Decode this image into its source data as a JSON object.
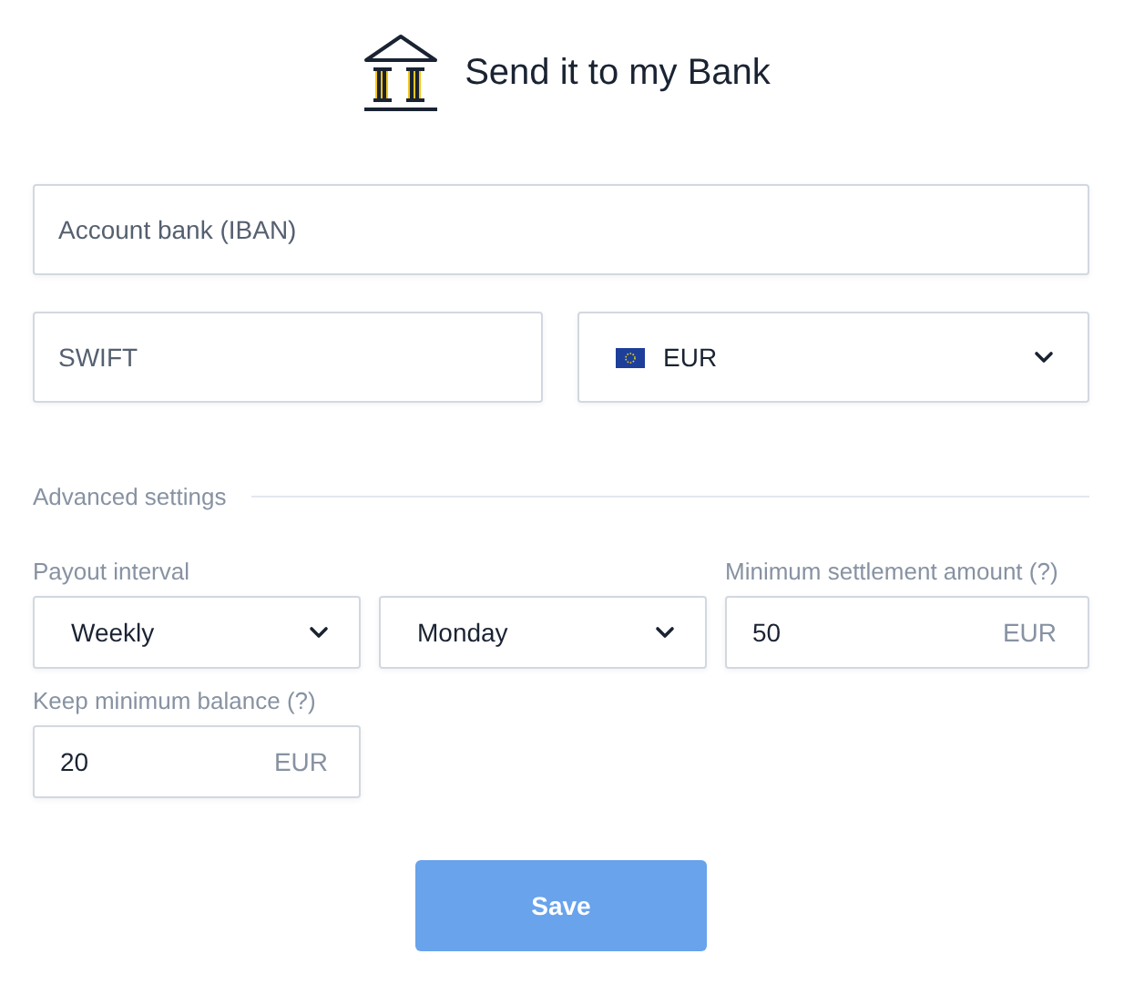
{
  "title": "Send it to my Bank",
  "iban": {
    "placeholder": "Account bank (IBAN)"
  },
  "swift": {
    "placeholder": "SWIFT"
  },
  "currency": {
    "value": "EUR"
  },
  "advanced": {
    "heading": "Advanced settings",
    "payout": {
      "label": "Payout interval",
      "interval": "Weekly",
      "day": "Monday"
    },
    "settlement": {
      "label": "Minimum settlement amount (?)",
      "value": "50",
      "unit": "EUR"
    },
    "balance": {
      "label": "Keep minimum balance (?)",
      "value": "20",
      "unit": "EUR"
    }
  },
  "save": "Save"
}
